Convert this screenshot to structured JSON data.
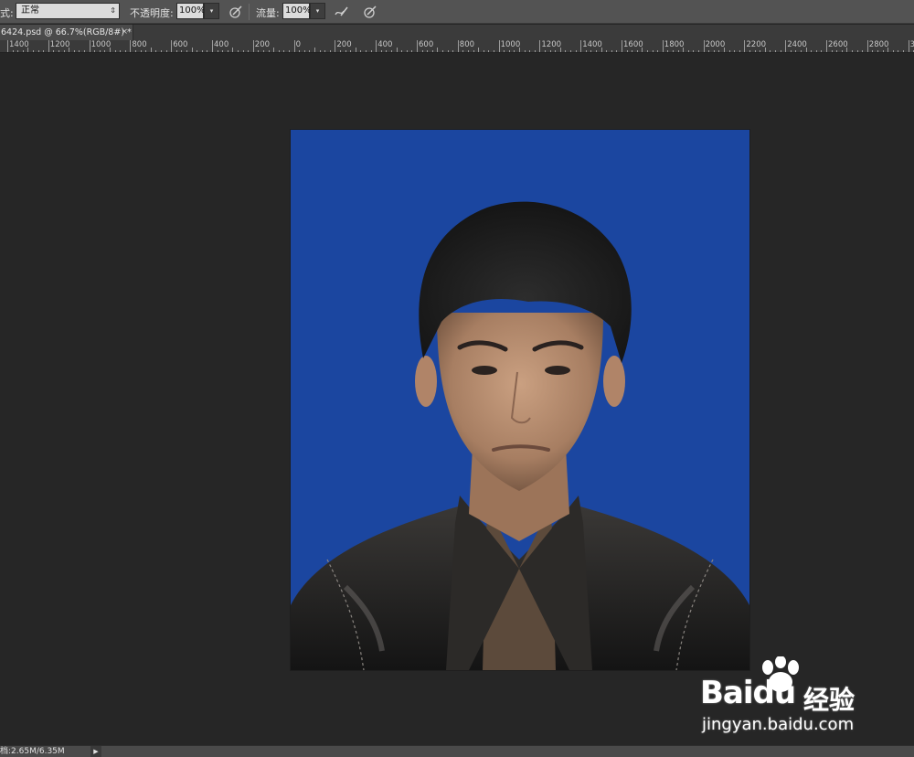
{
  "options_bar": {
    "mode_label": "式:",
    "mode_value": "正常",
    "opacity_label": "不透明度:",
    "opacity_value": "100%",
    "flow_label": "流量:",
    "flow_value": "100%",
    "icons": [
      "airbrush-pressure-icon",
      "airbrush-icon",
      "tablet-pressure-size-icon"
    ]
  },
  "document_tab": {
    "title": "6424.psd @ 66.7%(RGB/8#) *",
    "close": "×"
  },
  "ruler": {
    "labels": [
      "1400",
      "1200",
      "1000",
      "800",
      "600",
      "400",
      "200",
      "0",
      "200",
      "400",
      "600",
      "800",
      "1000",
      "1200",
      "1400",
      "1600",
      "1800",
      "2000",
      "2200",
      "2400",
      "2600",
      "2800",
      "30"
    ]
  },
  "canvas": {
    "photo_background_color": "#1b46a0",
    "workspace_color": "#262626"
  },
  "status_bar": {
    "doc_info": "档:2.65M/6.35M",
    "arrow": "▶"
  },
  "watermark": {
    "brand": "Bai",
    "brand2": "du",
    "chinese": "经验",
    "url": "jingyan.baidu.com"
  }
}
